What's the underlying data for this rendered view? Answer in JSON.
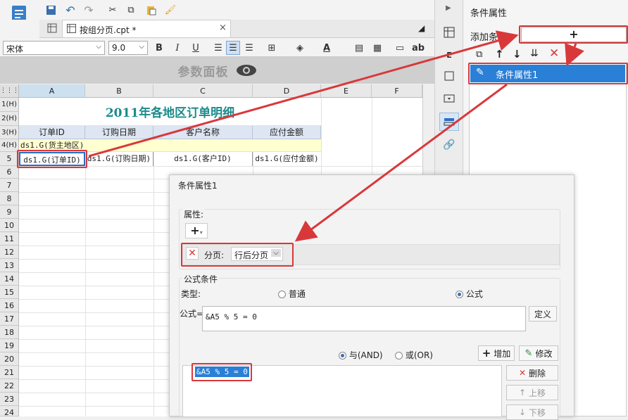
{
  "file_tab": {
    "title": "按组分页.cpt *"
  },
  "format_bar": {
    "font": "宋体",
    "size": "9.0",
    "bold": "B",
    "italic": "I",
    "underline": "U",
    "text_color": "A",
    "ab_label": "ab"
  },
  "param_panel": {
    "label": "参数面板"
  },
  "sheet": {
    "columns": [
      "A",
      "B",
      "C",
      "D",
      "E",
      "F"
    ],
    "rows": [
      "1(H)",
      "2(H)",
      "3(H)",
      "4(H)",
      "5",
      "7",
      "8",
      "9",
      "10",
      "11",
      "12",
      "13",
      "14",
      "15",
      "16",
      "17",
      "18",
      "19",
      "20",
      "21",
      "22",
      "23",
      "24"
    ],
    "title": "2011年各地区订单明细",
    "headers": [
      "订单ID",
      "订购日期",
      "客户名称",
      "应付金额"
    ],
    "group_row": "ds1.G(货主地区)",
    "data_row": [
      "ds1.G(订单ID)",
      "ds1.G(订购日期)",
      "ds1.G(客户ID)",
      "ds1.G(应付金额)"
    ]
  },
  "right_panel": {
    "title": "条件属性",
    "add_label": "添加条件",
    "add_button": "+",
    "item": "条件属性1"
  },
  "dialog": {
    "title": "条件属性1",
    "attr_label": "属性:",
    "pagination_label": "分页:",
    "pagination_value": "行后分页",
    "formula_section": "公式条件",
    "type_label": "类型:",
    "type_normal": "普通",
    "type_formula": "公式",
    "formula_label": "公式=",
    "formula_value": "&A5 % 5 = 0",
    "define_button": "定义",
    "and_label": "与(AND)",
    "or_label": "或(OR)",
    "add_button": "增加",
    "edit_button": "修改",
    "list_item": "&A5 % 5 = 0",
    "delete_button": "删除",
    "up_button": "上移",
    "down_button": "下移"
  },
  "colors": {
    "accent": "#3a7ec7",
    "highlight_red": "#d9383a",
    "title_teal": "#1a8b8b",
    "header_blue": "#dde6f2",
    "group_yellow": "#ffffd0"
  }
}
